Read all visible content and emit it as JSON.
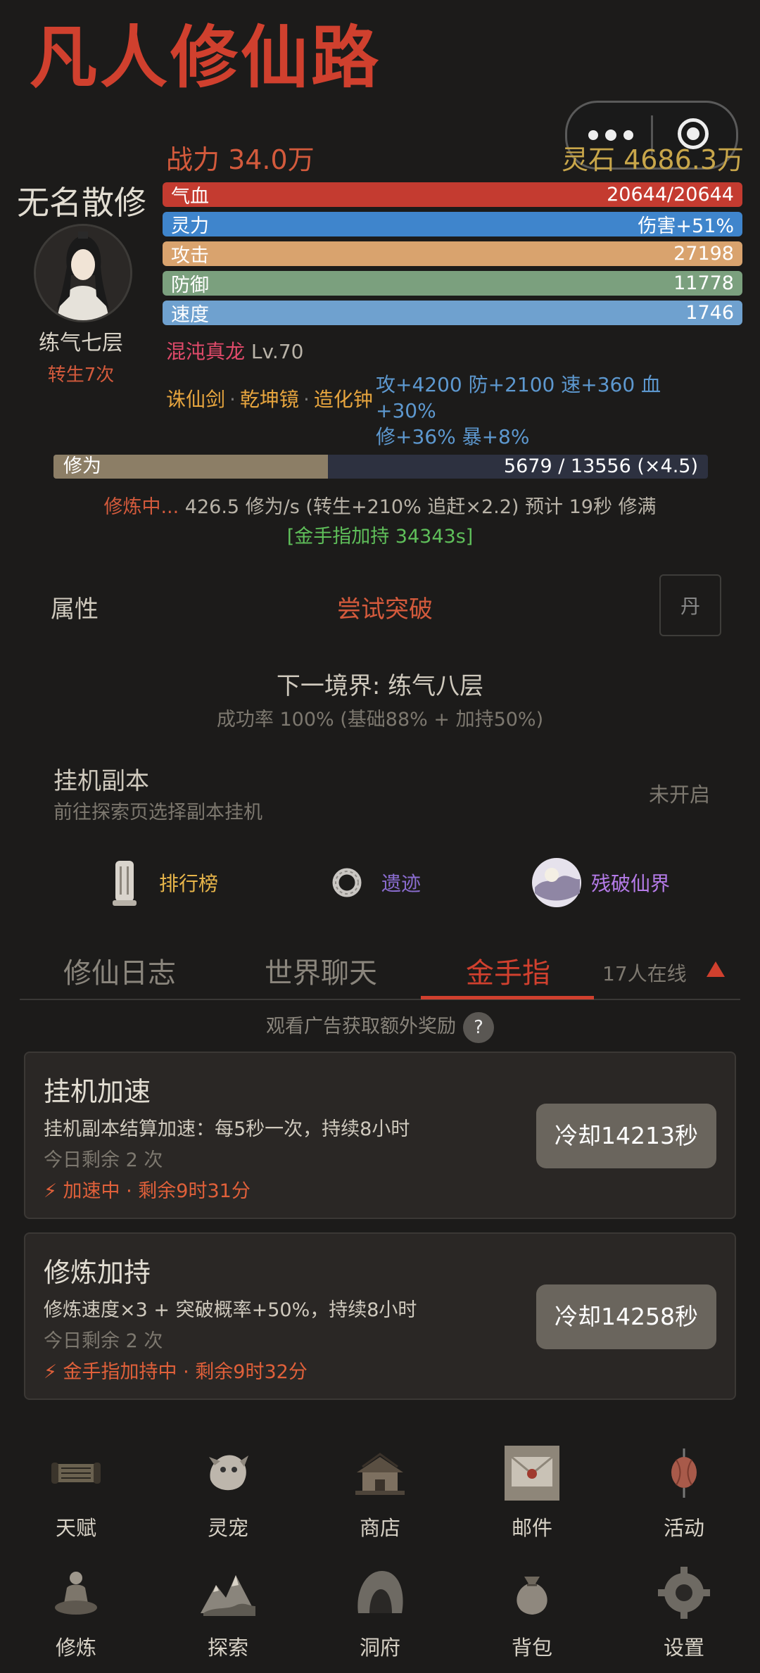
{
  "app_title": "凡人修仙路",
  "header": {
    "power_label": "战力 34.0万",
    "stones_label": "灵石 4686.3万"
  },
  "player": {
    "name": "无名散修",
    "realm": "练气七层",
    "rebirth": "转生7次"
  },
  "stats": [
    {
      "label": "气血",
      "value": "20644/20644",
      "color": "#c43b30"
    },
    {
      "label": "灵力",
      "value": "伤害+51%",
      "color": "#3f85cc"
    },
    {
      "label": "攻击",
      "value": "27198",
      "color": "#d9a36e"
    },
    {
      "label": "防御",
      "value": "11778",
      "color": "#7ba07e"
    },
    {
      "label": "速度",
      "value": "1746",
      "color": "#6fa1cf"
    }
  ],
  "pet": {
    "name": "混沌真龙",
    "level": "Lv.70"
  },
  "equipment": {
    "items": [
      "诛仙剑",
      "乾坤镜",
      "造化钟"
    ],
    "separator": "·",
    "bonus_line1": "攻+4200 防+2100 速+360 血+30%",
    "bonus_line2": "修+36% 暴+8%"
  },
  "cultivation": {
    "bar_label": "修为",
    "current": 5679,
    "max": 13556,
    "progress_text": "5679 / 13556 (×4.5)",
    "status": "修炼中...",
    "rate_text": " 426.5 修为/s (转生+210% 追赶×2.2) 预计 19秒 修满",
    "goldfinger_text": "[金手指加持 34343s]"
  },
  "actions": {
    "attributes": "属性",
    "breakthrough": "尝试突破",
    "pill": "丹"
  },
  "next_realm": {
    "title": "下一境界: 练气八层",
    "rate": "成功率 100% (基础88% + 加持50%)"
  },
  "afk": {
    "title": "挂机副本",
    "subtitle": "前往探索页选择副本挂机",
    "status": "未开启"
  },
  "quick_links": [
    {
      "label": "排行榜",
      "icon": "pillar-icon",
      "color": "#e7b54a"
    },
    {
      "label": "遗迹",
      "icon": "ring-icon",
      "color": "#8a6ccf"
    },
    {
      "label": "残破仙界",
      "icon": "realm-orb-icon",
      "color": "#b57be8"
    }
  ],
  "tabs": {
    "items": [
      "修仙日志",
      "世界聊天",
      "金手指"
    ],
    "active": "金手指",
    "online": "17人在线"
  },
  "ad_hint": "观看广告获取额外奖励",
  "ad_help": "?",
  "cards": [
    {
      "title": "挂机加速",
      "desc": "挂机副本结算加速：每5秒一次，持续8小时",
      "remain": "今日剩余 2 次",
      "status": "⚡ 加速中 · 剩余9时31分",
      "button": "冷却14213秒"
    },
    {
      "title": "修炼加持",
      "desc": "修炼速度×3 + 突破概率+50%，持续8小时",
      "remain": "今日剩余 2 次",
      "status": "⚡ 金手指加持中 · 剩余9时32分",
      "button": "冷却14258秒"
    }
  ],
  "bottom_grid": [
    {
      "label": "天赋",
      "icon": "scroll-icon"
    },
    {
      "label": "灵宠",
      "icon": "pet-icon"
    },
    {
      "label": "商店",
      "icon": "shop-icon"
    },
    {
      "label": "邮件",
      "icon": "mail-icon"
    },
    {
      "label": "活动",
      "icon": "lantern-icon"
    },
    {
      "label": "修炼",
      "icon": "meditation-icon"
    },
    {
      "label": "探索",
      "icon": "mountain-icon"
    },
    {
      "label": "洞府",
      "icon": "cave-icon"
    },
    {
      "label": "背包",
      "icon": "bag-icon"
    },
    {
      "label": "设置",
      "icon": "gear-icon"
    }
  ]
}
